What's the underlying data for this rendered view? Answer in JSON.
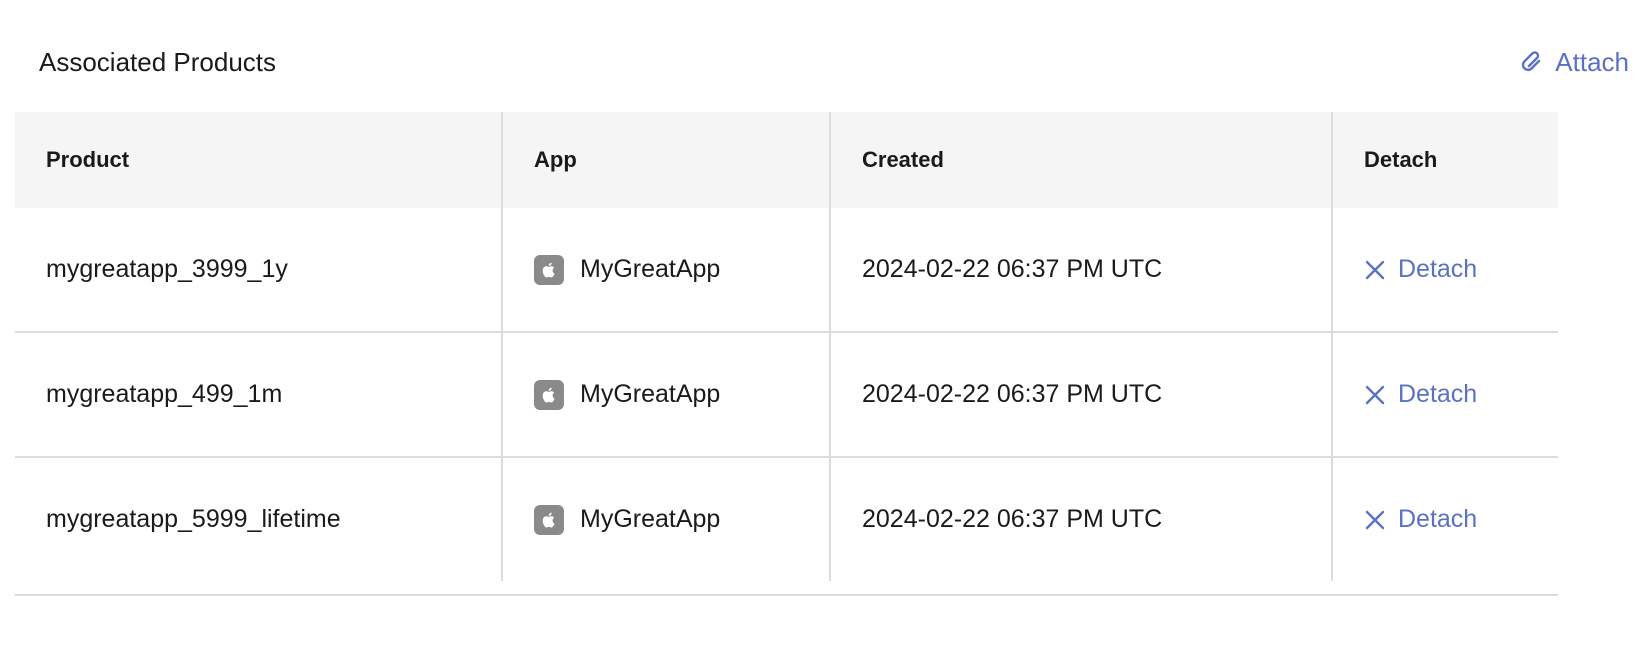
{
  "section": {
    "title": "Associated Products",
    "attach_label": "Attach"
  },
  "table": {
    "headers": {
      "product": "Product",
      "app": "App",
      "created": "Created",
      "detach": "Detach"
    },
    "rows": [
      {
        "product": "mygreatapp_3999_1y",
        "app": "MyGreatApp",
        "app_icon": "apple-icon",
        "created": "2024-02-22 06:37 PM UTC",
        "detach_label": "Detach"
      },
      {
        "product": "mygreatapp_499_1m",
        "app": "MyGreatApp",
        "app_icon": "apple-icon",
        "created": "2024-02-22 06:37 PM UTC",
        "detach_label": "Detach"
      },
      {
        "product": "mygreatapp_5999_lifetime",
        "app": "MyGreatApp",
        "app_icon": "apple-icon",
        "created": "2024-02-22 06:37 PM UTC",
        "detach_label": "Detach"
      }
    ]
  },
  "colors": {
    "link": "#5b72c2",
    "header_bg": "#f5f5f5",
    "border": "#dcdcdc",
    "app_badge": "#8a8a8a"
  }
}
